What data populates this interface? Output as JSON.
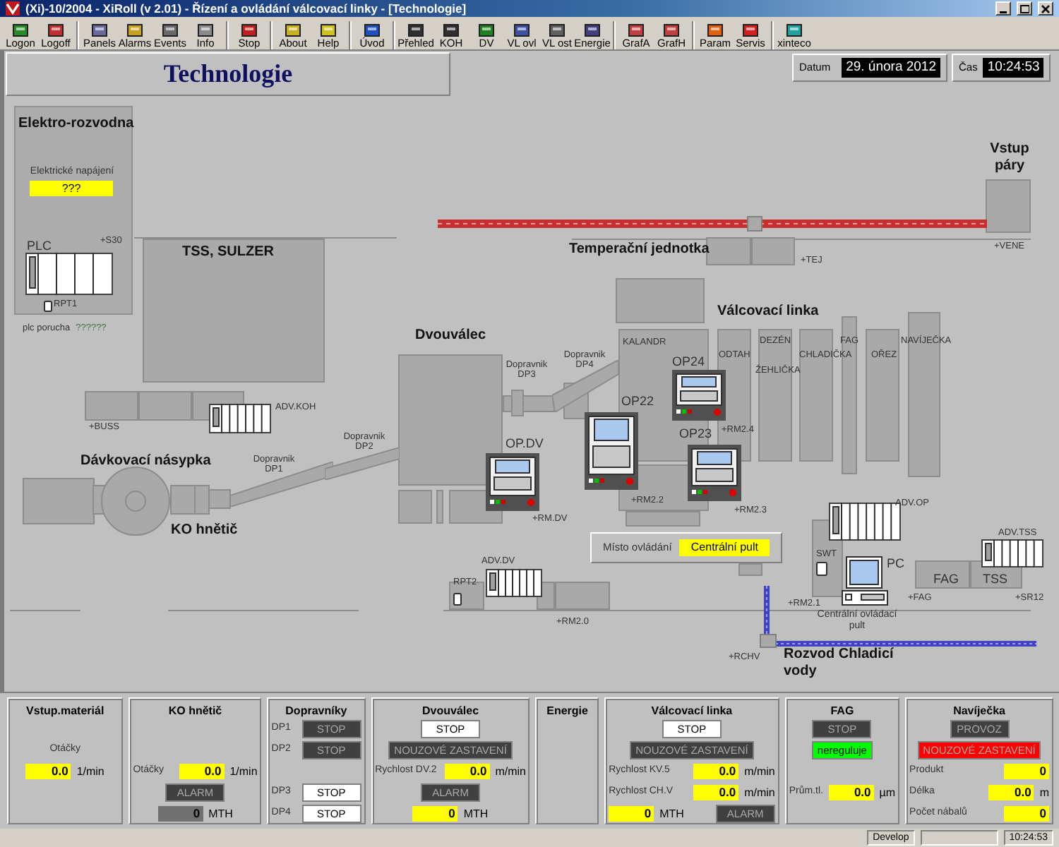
{
  "window": {
    "title": "(Xi)-10/2004 - XiRoll (v 2.01) - Řízení a ovládání válcovací linky - [Technologie]"
  },
  "toolbar": [
    [
      {
        "label": "Logon"
      },
      {
        "label": "Logoff"
      }
    ],
    [
      {
        "label": "Panels"
      },
      {
        "label": "Alarms"
      },
      {
        "label": "Events"
      },
      {
        "label": "Info"
      }
    ],
    [
      {
        "label": "Stop"
      }
    ],
    [
      {
        "label": "About"
      },
      {
        "label": "Help"
      }
    ],
    [
      {
        "label": "Úvod"
      }
    ],
    [
      {
        "label": "Přehled"
      },
      {
        "label": "KOH"
      },
      {
        "label": "DV"
      },
      {
        "label": "VL ovl"
      },
      {
        "label": "VL ost"
      },
      {
        "label": "Energie"
      }
    ],
    [
      {
        "label": "GrafA"
      },
      {
        "label": "GrafH"
      }
    ],
    [
      {
        "label": "Param"
      },
      {
        "label": "Servis"
      }
    ],
    [
      {
        "label": "xinteco"
      }
    ]
  ],
  "header": {
    "title": "Technologie",
    "date_label": "Datum",
    "date": "29. února 2012",
    "time_label": "Čas",
    "time": "10:24:53"
  },
  "diagram": {
    "labels": [
      {
        "text": "Elektro-rozvodna",
        "kind": "heading"
      },
      {
        "text": "Elektrické napájení",
        "kind": "name"
      },
      {
        "text": "PLC",
        "kind": "device"
      },
      {
        "text": "+S30",
        "kind": "tag"
      },
      {
        "text": "RPT1",
        "kind": "tag"
      },
      {
        "text": "TSS, SULZER",
        "kind": "heading"
      },
      {
        "text": "Vstup páry",
        "kind": "heading"
      },
      {
        "text": "Temperační jednotka",
        "kind": "heading"
      },
      {
        "text": "+TEJ",
        "kind": "tag"
      },
      {
        "text": "+VENE",
        "kind": "tag"
      },
      {
        "text": "Válcovací linka",
        "kind": "heading"
      },
      {
        "text": "KALANDR",
        "kind": "tag"
      },
      {
        "text": "ODTAH",
        "kind": "tag"
      },
      {
        "text": "DEZÉN",
        "kind": "tag"
      },
      {
        "text": "ŽEHLIČKA",
        "kind": "tag"
      },
      {
        "text": "CHLADIČKA",
        "kind": "tag"
      },
      {
        "text": "FAG",
        "kind": "tag"
      },
      {
        "text": "OŘEZ",
        "kind": "tag"
      },
      {
        "text": "NAVÍJEČKA",
        "kind": "tag"
      },
      {
        "text": "Dvouválec",
        "kind": "heading"
      },
      {
        "text": "Dopravnik DP3",
        "kind": "tag"
      },
      {
        "text": "Dopravnik DP4",
        "kind": "tag"
      },
      {
        "text": "+BUSS",
        "kind": "tag"
      },
      {
        "text": "ADV.KOH",
        "kind": "tag"
      },
      {
        "text": "Dávkovací násypka",
        "kind": "heading"
      },
      {
        "text": "Dopravnik DP1",
        "kind": "tag"
      },
      {
        "text": "Dopravnik DP2",
        "kind": "tag"
      },
      {
        "text": "KO hnětič",
        "kind": "heading"
      },
      {
        "text": "OP.DV",
        "kind": "device"
      },
      {
        "text": "OP22",
        "kind": "device"
      },
      {
        "text": "OP24",
        "kind": "device"
      },
      {
        "text": "OP23",
        "kind": "device"
      },
      {
        "text": "+RM.DV",
        "kind": "tag"
      },
      {
        "text": "+RM2.4",
        "kind": "tag"
      },
      {
        "text": "+RM2.2",
        "kind": "tag"
      },
      {
        "text": "+RM2.3",
        "kind": "tag"
      },
      {
        "text": "ADV.OP",
        "kind": "tag"
      },
      {
        "text": "ADV.TSS",
        "kind": "tag"
      },
      {
        "text": "SWT",
        "kind": "tag"
      },
      {
        "text": "PC",
        "kind": "device"
      },
      {
        "text": "FAG",
        "kind": "device"
      },
      {
        "text": "TSS",
        "kind": "device"
      },
      {
        "text": "+FAG",
        "kind": "tag"
      },
      {
        "text": "+SR12",
        "kind": "tag"
      },
      {
        "text": "+RM2.1",
        "kind": "tag"
      },
      {
        "text": "Centrální ovládací pult",
        "kind": "name"
      },
      {
        "text": "ADV.DV",
        "kind": "tag"
      },
      {
        "text": "RPT2",
        "kind": "tag"
      },
      {
        "text": "+RM2.0",
        "kind": "tag"
      },
      {
        "text": "+RCHV",
        "kind": "tag"
      },
      {
        "text": "Rozvod Chladicí vody",
        "kind": "heading"
      }
    ],
    "power_value": "???",
    "plc_status_label": "plc porucha",
    "plc_status_value": "??????",
    "control_place": {
      "label": "Místo ovládání",
      "value": "Centrální pult"
    }
  },
  "status_panels": [
    {
      "title": "Vstup.materiál",
      "rows": [
        [
          {
            "kind": "label",
            "text": "Otáčky"
          }
        ],
        [
          {
            "kind": "value",
            "text": "0.0",
            "unit": "1/min",
            "color": "#ffff00"
          }
        ]
      ]
    },
    {
      "title": "KO hnětič",
      "rows": [
        [
          {
            "kind": "label",
            "text": "Otáčky"
          },
          {
            "kind": "value",
            "text": "0.0",
            "unit": "1/min",
            "color": "#ffff00"
          }
        ],
        [
          {
            "kind": "indicator",
            "text": "ALARM",
            "color": "#404040"
          }
        ],
        [
          {
            "kind": "value",
            "text": "0",
            "unit": "MTH",
            "color": "#707070"
          }
        ]
      ]
    },
    {
      "title": "Dopravníky",
      "rows": [
        [
          {
            "kind": "label",
            "text": "DP1"
          },
          {
            "kind": "indicator",
            "text": "STOP",
            "color": "#404040"
          }
        ],
        [
          {
            "kind": "label",
            "text": "DP2"
          },
          {
            "kind": "indicator",
            "text": "STOP",
            "color": "#404040"
          }
        ],
        [
          {
            "kind": "label",
            "text": "DP3"
          },
          {
            "kind": "indicator",
            "text": "STOP",
            "color": "#ffffff"
          }
        ],
        [
          {
            "kind": "label",
            "text": "DP4"
          },
          {
            "kind": "indicator",
            "text": "STOP",
            "color": "#ffffff"
          }
        ]
      ]
    },
    {
      "title": "Dvouválec",
      "rows": [
        [
          {
            "kind": "indicator",
            "text": "STOP",
            "color": "#ffffff"
          }
        ],
        [
          {
            "kind": "indicator",
            "text": "NOUZOVÉ ZASTAVENÍ",
            "color": "#404040"
          }
        ],
        [
          {
            "kind": "label",
            "text": "Rychlost DV.2"
          },
          {
            "kind": "value",
            "text": "0.0",
            "unit": "m/min",
            "color": "#ffff00"
          }
        ],
        [
          {
            "kind": "indicator",
            "text": "ALARM",
            "color": "#404040"
          }
        ],
        [
          {
            "kind": "value",
            "text": "0",
            "unit": "MTH",
            "color": "#ffff00"
          }
        ]
      ]
    },
    {
      "title": "Energie"
    },
    {
      "title": "Válcovací linka",
      "rows": [
        [
          {
            "kind": "indicator",
            "text": "STOP",
            "color": "#ffffff"
          }
        ],
        [
          {
            "kind": "indicator",
            "text": "NOUZOVÉ ZASTAVENÍ",
            "color": "#404040"
          }
        ],
        [
          {
            "kind": "label",
            "text": "Rychlost KV.5"
          },
          {
            "kind": "value",
            "text": "0.0",
            "unit": "m/min",
            "color": "#ffff00"
          }
        ],
        [
          {
            "kind": "label",
            "text": "Rychlost CH.V"
          },
          {
            "kind": "value",
            "text": "0.0",
            "unit": "m/min",
            "color": "#ffff00"
          }
        ],
        [
          {
            "kind": "value",
            "text": "0",
            "unit": "MTH",
            "color": "#ffff00"
          },
          {
            "kind": "indicator",
            "text": "ALARM",
            "color": "#404040"
          }
        ]
      ]
    },
    {
      "title": "FAG",
      "rows": [
        [
          {
            "kind": "indicator",
            "text": "STOP",
            "color": "#404040"
          }
        ],
        [
          {
            "kind": "indicator",
            "text": "nereguluje",
            "color": "#00ff00"
          }
        ],
        [
          {
            "kind": "label",
            "text": "Prům.tl."
          },
          {
            "kind": "value",
            "text": "0.0",
            "unit": "µm",
            "color": "#ffff00"
          }
        ]
      ]
    },
    {
      "title": "Navíječka",
      "rows": [
        [
          {
            "kind": "indicator",
            "text": "PROVOZ",
            "color": "#404040"
          }
        ],
        [
          {
            "kind": "indicator",
            "text": "NOUZOVÉ ZASTAVENÍ",
            "color": "#ff0000"
          }
        ],
        [
          {
            "kind": "label",
            "text": "Produkt"
          },
          {
            "kind": "value",
            "text": "0",
            "color": "#ffff00"
          }
        ],
        [
          {
            "kind": "label",
            "text": "Délka"
          },
          {
            "kind": "value",
            "text": "0.0",
            "unit": "m",
            "color": "#ffff00"
          }
        ],
        [
          {
            "kind": "label",
            "text": "Počet nábalů"
          },
          {
            "kind": "value",
            "text": "0",
            "color": "#ffff00"
          }
        ]
      ]
    }
  ],
  "status_bar": {
    "mode": "Develop",
    "time": "10:24:53"
  }
}
